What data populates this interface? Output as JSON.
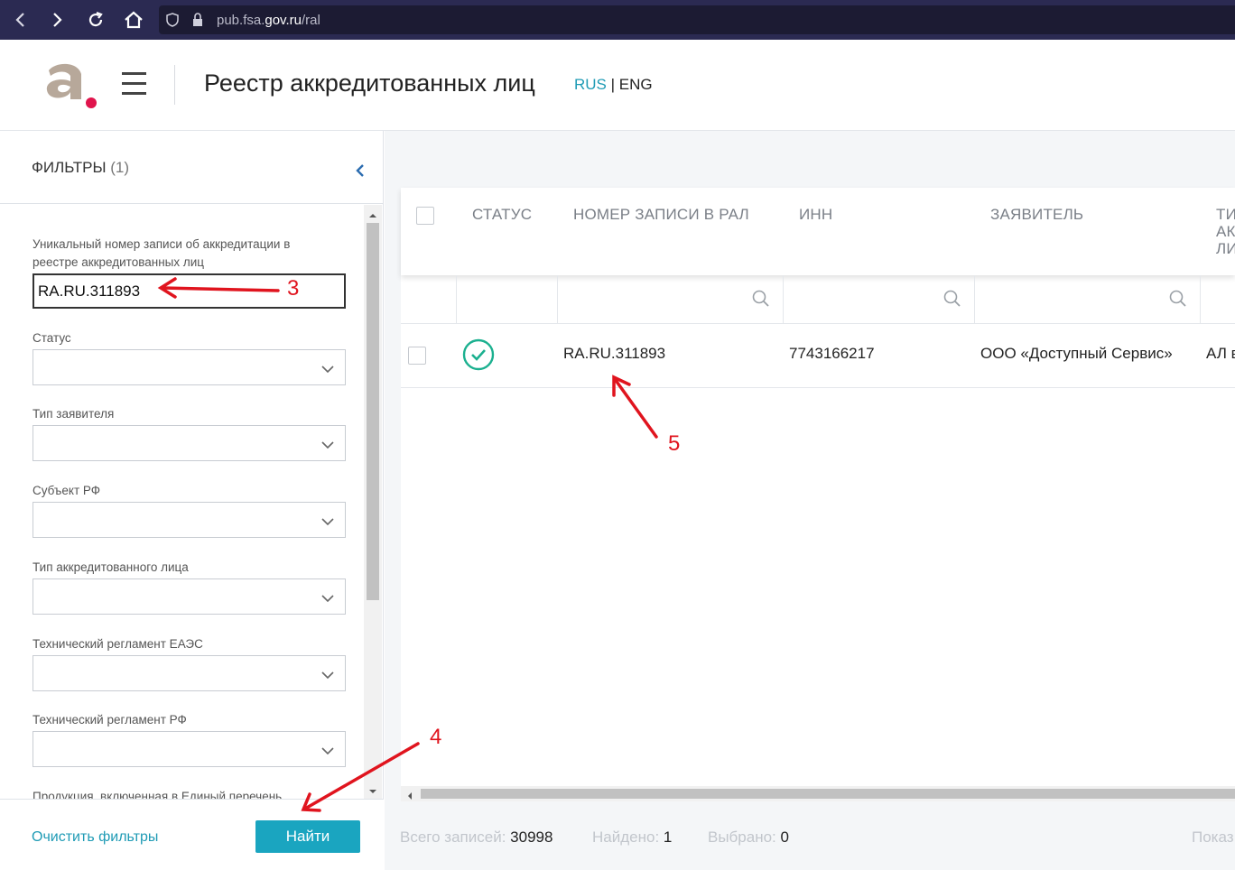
{
  "browser": {
    "url_prefix": "pub.fsa.",
    "url_domain": "gov.ru",
    "url_path": "/ral"
  },
  "header": {
    "title": "Реестр аккредитованных лиц",
    "lang_rus": "RUS",
    "lang_sep": " | ",
    "lang_eng": "ENG"
  },
  "sidebar": {
    "filters_title": "ФИЛЬТРЫ",
    "filters_count": "(1)",
    "fields": [
      {
        "label": "Уникальный номер записи об аккредитации в реестре аккредитованных лиц",
        "value": "RA.RU.311893"
      },
      {
        "label": "Статус",
        "value": ""
      },
      {
        "label": "Тип заявителя",
        "value": ""
      },
      {
        "label": "Субъект РФ",
        "value": ""
      },
      {
        "label": "Тип аккредитованного лица",
        "value": ""
      },
      {
        "label": "Технический регламент ЕАЭС",
        "value": ""
      },
      {
        "label": "Технический регламент РФ",
        "value": ""
      },
      {
        "label": "Продукция, включенная в Единый перечень",
        "value": ""
      }
    ],
    "clear_label": "Очистить фильтры",
    "find_label": "Найти"
  },
  "table": {
    "headers": [
      "СТАТУС",
      "НОМЕР ЗАПИСИ В РАЛ",
      "ИНН",
      "ЗАЯВИТЕЛЬ",
      "ТИП АККРЕДИТОВАННОГО ЛИЦА"
    ],
    "header_last_visible": [
      "ТИ",
      "АК",
      "ЛИ"
    ],
    "rows": [
      {
        "status": "active",
        "number": "RA.RU.311893",
        "inn": "7743166217",
        "applicant": "ООО «Доступный Сервис»",
        "type": "АЛ в"
      }
    ]
  },
  "footer": {
    "total_label": "Всего записей:",
    "total_value": "30998",
    "found_label": "Найдено:",
    "found_value": "1",
    "selected_label": "Выбрано:",
    "selected_value": "0",
    "show_label": "Показ"
  },
  "annotations": [
    "3",
    "4",
    "5"
  ],
  "colors": {
    "accent": "#1aa5c0",
    "status_ok": "#1bb08f",
    "annotation": "#e0141e",
    "logo_dot": "#e0144c"
  }
}
